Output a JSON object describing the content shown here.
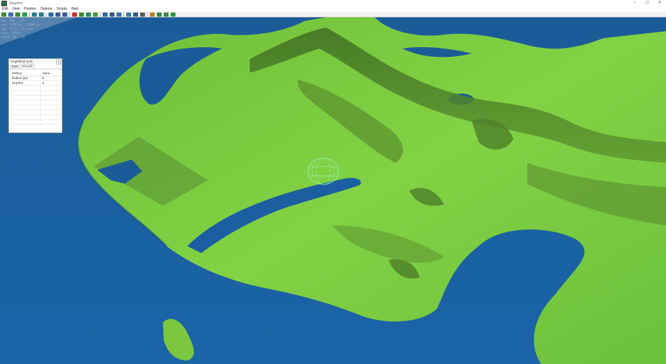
{
  "window": {
    "title": "Sapphire",
    "controls": [
      "–",
      "▢",
      "✕"
    ]
  },
  "menu": [
    "Edit",
    "View",
    "Position",
    "Options",
    "Scripts",
    "Help"
  ],
  "toolbar": {
    "buttons": [
      {
        "name": "new-button",
        "color": "#3a8a3a"
      },
      {
        "name": "open-button",
        "color": "#3a6aa8"
      },
      {
        "name": "save-button",
        "color": "#3a8a3a"
      },
      {
        "name": "export-button",
        "color": "#2a9a4a"
      },
      {
        "name": "sep"
      },
      {
        "name": "undo-button",
        "color": "#2a7a8a"
      },
      {
        "name": "redo-button",
        "color": "#2a7a8a"
      },
      {
        "name": "sep"
      },
      {
        "name": "select-button",
        "color": "#2a6a9a"
      },
      {
        "name": "move-button",
        "color": "#3a5a9a"
      },
      {
        "name": "rotate-button",
        "color": "#3a5a9a"
      },
      {
        "name": "sep"
      },
      {
        "name": "paint-button",
        "color": "#c03030"
      },
      {
        "name": "raise-button",
        "color": "#3a8a3a"
      },
      {
        "name": "lower-button",
        "color": "#2a8a5a"
      },
      {
        "name": "flatten-button",
        "color": "#4a9a3a"
      },
      {
        "name": "sep"
      },
      {
        "name": "smooth-button",
        "color": "#2a6a9a"
      },
      {
        "name": "heightfield-button",
        "color": "#3a5a8a"
      },
      {
        "name": "water-button",
        "color": "#3a6aaa"
      },
      {
        "name": "sep"
      },
      {
        "name": "grid-button",
        "color": "#3a7a9a"
      },
      {
        "name": "wireframe-button",
        "color": "#2a5a8a"
      },
      {
        "name": "camera-button",
        "color": "#5a5a5a"
      },
      {
        "name": "sep"
      },
      {
        "name": "light-button",
        "color": "#c07a20"
      },
      {
        "name": "fog-button",
        "color": "#3a8a3a"
      },
      {
        "name": "sky-button",
        "color": "#3a8a3a"
      },
      {
        "name": "play-button",
        "color": "#2a9a3a"
      }
    ]
  },
  "stats": [
    "pos: 496 ; 313",
    "ent: 1709 ms ; 14109 ms",
    "fps: 16.3 ; 24.9 ms",
    "tris: 32708",
    "batch: 45 ; 22"
  ],
  "panel": {
    "title": "Heightfield tools",
    "close": "✕",
    "tabs": [
      "Tools",
      "Smooth"
    ],
    "active_tab": "Smooth",
    "headers": [
      "Setting",
      "Value"
    ],
    "rows": [
      {
        "setting": "Radius (px)",
        "value": "8"
      },
      {
        "setting": "nCycles",
        "value": "3"
      }
    ]
  },
  "colors": {
    "water": "#1a5fa0",
    "water_dark": "#124a80",
    "land": "#7fcf42",
    "land_dark": "#4f8a2a",
    "brush": "#8fffb0"
  }
}
